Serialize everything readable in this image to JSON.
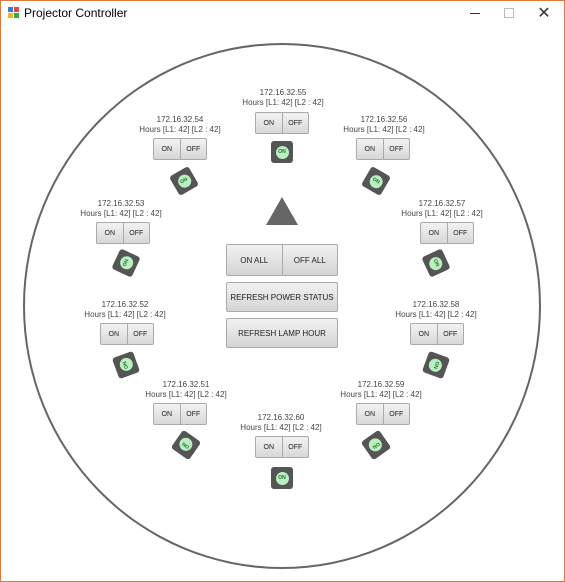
{
  "window": {
    "title": "Projector Controller"
  },
  "projectors": [
    {
      "ip": "172.16.32.55",
      "hours": "Hours [L1: 42] [L2 : 42]",
      "on_label": "ON",
      "off_label": "OFF",
      "status": "ON"
    },
    {
      "ip": "172.16.32.54",
      "hours": "Hours [L1: 42] [L2 : 42]",
      "on_label": "ON",
      "off_label": "OFF",
      "status": "ON"
    },
    {
      "ip": "172.16.32.56",
      "hours": "Hours [L1: 42] [L2 : 42]",
      "on_label": "ON",
      "off_label": "OFF",
      "status": "ON"
    },
    {
      "ip": "172.16.32.53",
      "hours": "Hours [L1: 42] [L2 : 42]",
      "on_label": "ON",
      "off_label": "OFF",
      "status": "ON"
    },
    {
      "ip": "172.16.32.57",
      "hours": "Hours [L1: 42] [L2 : 42]",
      "on_label": "ON",
      "off_label": "OFF",
      "status": "ON"
    },
    {
      "ip": "172.16.32.52",
      "hours": "Hours [L1: 42] [L2 : 42]",
      "on_label": "ON",
      "off_label": "OFF",
      "status": "ON"
    },
    {
      "ip": "172.16.32.58",
      "hours": "Hours [L1: 42] [L2 : 42]",
      "on_label": "ON",
      "off_label": "OFF",
      "status": "ON"
    },
    {
      "ip": "172.16.32.51",
      "hours": "Hours [L1: 42] [L2 : 42]",
      "on_label": "ON",
      "off_label": "OFF",
      "status": "ON"
    },
    {
      "ip": "172.16.32.59",
      "hours": "Hours [L1: 42] [L2 : 42]",
      "on_label": "ON",
      "off_label": "OFF",
      "status": "ON"
    },
    {
      "ip": "172.16.32.60",
      "hours": "Hours [L1: 42] [L2 : 42]",
      "on_label": "ON",
      "off_label": "OFF",
      "status": "ON"
    }
  ],
  "controls": {
    "on_all": "ON ALL",
    "off_all": "OFF ALL",
    "refresh_power": "REFRESH POWER STATUS",
    "refresh_lamp": "REFRESH LAMP HOUR"
  },
  "colors": {
    "status_on": "#b9f0c0",
    "window_border": "#e07a3c"
  }
}
